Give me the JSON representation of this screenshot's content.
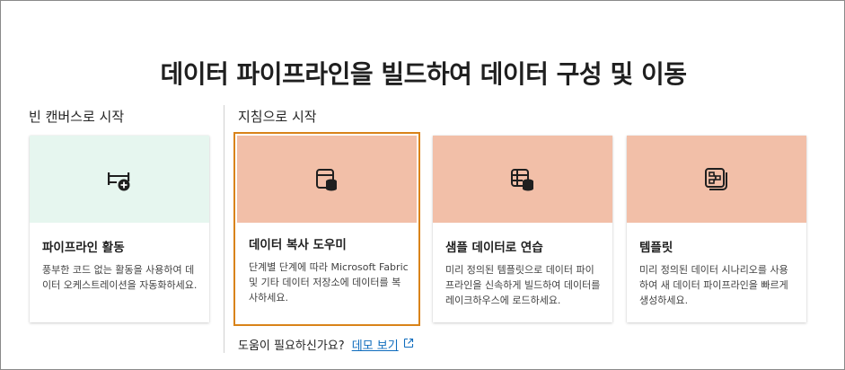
{
  "title": "데이터 파이프라인을 빌드하여 데이터 구성 및 이동",
  "sections": {
    "blank": "빈 캔버스로 시작",
    "guided": "지침으로 시작"
  },
  "cards": [
    {
      "title": "파이프라인 활동",
      "desc": "풍부한 코드 없는 활동을 사용하여 데이터 오케스트레이션을 자동화하세요.",
      "icon": "pipeline-activity-icon"
    },
    {
      "title": "데이터 복사 도우미",
      "desc": "단계별 단계에 따라 Microsoft Fabric 및 기타 데이터 저장소에 데이터를 복사하세요.",
      "icon": "copy-data-icon"
    },
    {
      "title": "샘플 데이터로 연습",
      "desc": "미리 정의된 템플릿으로 데이터 파이프라인을 신속하게 빌드하여 데이터를 레이크하우스에 로드하세요.",
      "icon": "sample-data-icon"
    },
    {
      "title": "템플릿",
      "desc": "미리 정의된 데이터 시나리오를 사용하여 새 데이터 파이프라인을 빠르게 생성하세요.",
      "icon": "template-icon"
    }
  ],
  "help": {
    "question": "도움이 필요하신가요?",
    "link": "데모 보기"
  },
  "colors": {
    "accent_border": "#d98319",
    "hero_green": "#e6f6ef",
    "hero_salmon": "#f2bfa8",
    "link": "#0f6cbd"
  }
}
